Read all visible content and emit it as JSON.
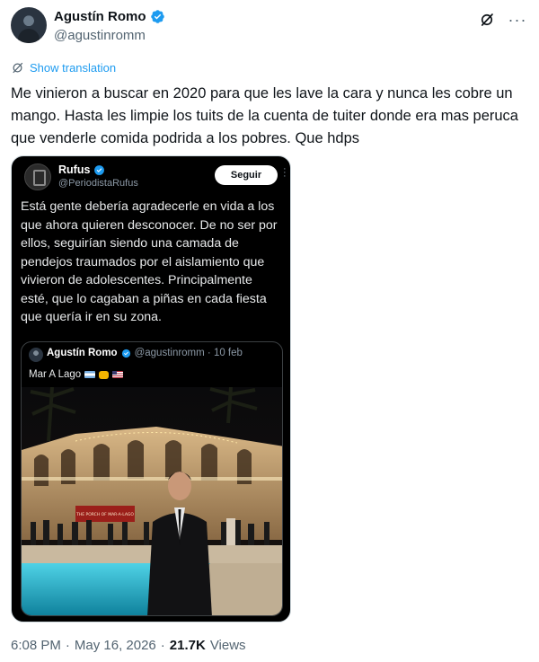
{
  "author": {
    "display_name": "Agustín Romo",
    "handle": "@agustinromm"
  },
  "actions": {
    "grok_icon": "grok-icon",
    "more_icon": "more-icon",
    "more_glyph": "···"
  },
  "translation": {
    "label": "Show translation"
  },
  "tweet": {
    "text": "Me vinieron a buscar en 2020 para que les lave la cara y nunca les cobre un mango. Hasta les limpie los tuits de la cuenta de tuiter donde era mas peruca que venderle comida podrida a los pobres. Que hdps"
  },
  "embedded": {
    "name": "Rufus",
    "handle": "@PeriodistaRufus",
    "follow_label": "Seguir",
    "text": "Está gente debería agradecerle en vida a los que ahora quieren desconocer. De no ser por ellos, seguirían siendo una camada de pendejos traumados por el aislamiento que vivieron de adolescentes. Principalmente esté, que lo cagaban a piñas en cada fiesta que quería ir en su zona.",
    "quote": {
      "name": "Agustín Romo",
      "handle_date": "@agustinromm · 10 feb",
      "text": "Mar A Lago",
      "photo_sign": "THE PORCH OF MAR-A-LAGO"
    }
  },
  "meta": {
    "time": "6:08 PM",
    "date": "May 16, 2026",
    "views_count": "21.7K",
    "views_label": "Views",
    "sep": "·"
  },
  "colors": {
    "accent": "#1d9bf0",
    "text": "#0f1419",
    "muted": "#536471"
  }
}
